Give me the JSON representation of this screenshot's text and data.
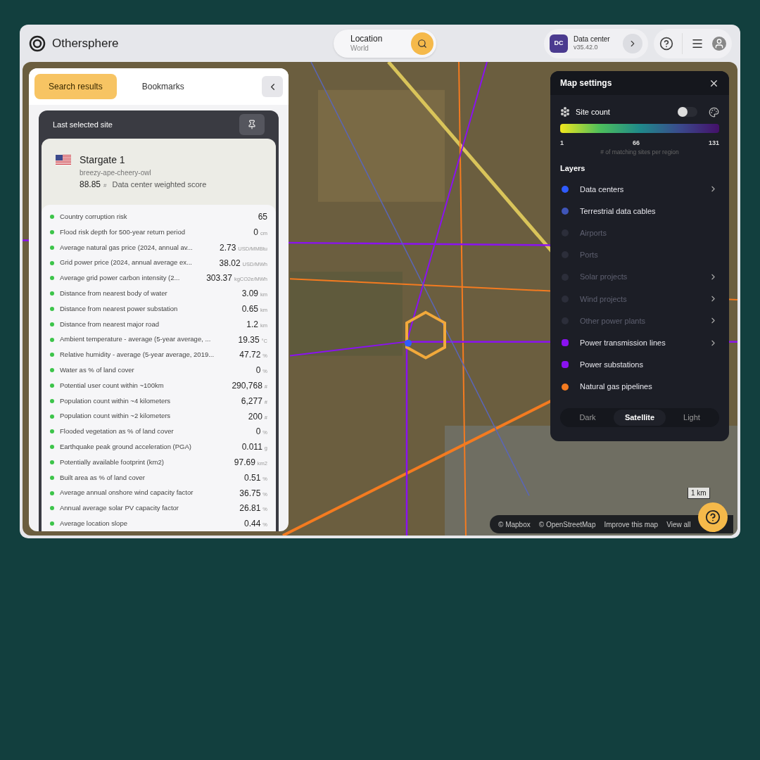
{
  "header": {
    "brand": "Othersphere",
    "location": {
      "label": "Location",
      "value": "World"
    },
    "workspace": {
      "badge": "DC",
      "name": "Data center",
      "version": "v35.42.0"
    }
  },
  "left_panel": {
    "tabs": [
      {
        "label": "Search results",
        "selected": true
      },
      {
        "label": "Bookmarks",
        "selected": false
      }
    ],
    "card_title": "Last selected site",
    "site": {
      "name": "Stargate 1",
      "slug": "breezy-ape-cheery-owl",
      "score": "88.85",
      "score_unit": "#",
      "score_label": "Data center weighted score"
    },
    "metrics": [
      {
        "label": "Country corruption risk",
        "value": "65"
      },
      {
        "label": "Flood risk depth for 500-year return period",
        "value": "0",
        "unit": "cm"
      },
      {
        "label": "Average natural gas price (2024, annual av...",
        "value": "2.73",
        "unit": "USD/MMBtu"
      },
      {
        "label": "Grid power price (2024, annual average ex...",
        "value": "38.02",
        "unit": "USD/MWh"
      },
      {
        "label": "Average grid power carbon intensity (2...",
        "value": "303.37",
        "unit": "kgCO2e/MWh"
      },
      {
        "label": "Distance from nearest body of water",
        "value": "3.09",
        "unit": "km"
      },
      {
        "label": "Distance from nearest power substation",
        "value": "0.65",
        "unit": "km"
      },
      {
        "label": "Distance from nearest major road",
        "value": "1.2",
        "unit": "km"
      },
      {
        "label": "Ambient temperature - average (5-year average, ...",
        "value": "19.35",
        "unit": "°C"
      },
      {
        "label": "Relative humidity - average (5-year average, 2019...",
        "value": "47.72",
        "unit": "%"
      },
      {
        "label": "Water as % of land cover",
        "value": "0",
        "unit": "%"
      },
      {
        "label": "Potential user count within ~100km",
        "value": "290,768",
        "unit": "#"
      },
      {
        "label": "Population count within ~4 kilometers",
        "value": "6,277",
        "unit": "#"
      },
      {
        "label": "Population count within ~2 kilometers",
        "value": "200",
        "unit": "#"
      },
      {
        "label": "Flooded vegetation as % of land cover",
        "value": "0",
        "unit": "%"
      },
      {
        "label": "Earthquake peak ground acceleration (PGA)",
        "value": "0.011",
        "unit": "g"
      },
      {
        "label": "Potentially available footprint (km2)",
        "value": "97.69",
        "unit": "km2"
      },
      {
        "label": "Built area as % of land cover",
        "value": "0.51",
        "unit": "%"
      },
      {
        "label": "Average annual onshore wind capacity factor",
        "value": "36.75",
        "unit": "%"
      },
      {
        "label": "Annual average solar PV capacity factor",
        "value": "26.81",
        "unit": "%"
      },
      {
        "label": "Average location slope",
        "value": "0.44",
        "unit": "%"
      }
    ]
  },
  "map_settings": {
    "title": "Map settings",
    "site_count": {
      "label": "Site count",
      "on": false,
      "min": "1",
      "mid": "66",
      "max": "131",
      "caption": "# of matching sites per region"
    },
    "layers_title": "Layers",
    "layers": [
      {
        "label": "Data centers",
        "enabled": true,
        "color": "#2f5bff",
        "kind": "circle",
        "submenu": true
      },
      {
        "label": "Terrestrial data cables",
        "enabled": true,
        "color": "#3f55b8",
        "kind": "circle",
        "submenu": false
      },
      {
        "label": "Airports",
        "enabled": false,
        "color": "#2c2e3a",
        "kind": "circle",
        "submenu": false
      },
      {
        "label": "Ports",
        "enabled": false,
        "color": "#2c2e3a",
        "kind": "circle",
        "submenu": false
      },
      {
        "label": "Solar projects",
        "enabled": false,
        "color": "#2c2e3a",
        "kind": "circle",
        "submenu": true
      },
      {
        "label": "Wind projects",
        "enabled": false,
        "color": "#2c2e3a",
        "kind": "circle",
        "submenu": true
      },
      {
        "label": "Other power plants",
        "enabled": false,
        "color": "#2c2e3a",
        "kind": "circle",
        "submenu": true
      },
      {
        "label": "Power transmission lines",
        "enabled": true,
        "color": "#8a12f0",
        "kind": "square",
        "submenu": true
      },
      {
        "label": "Power substations",
        "enabled": true,
        "color": "#8a12f0",
        "kind": "square",
        "submenu": false
      },
      {
        "label": "Natural gas pipelines",
        "enabled": true,
        "color": "#f47b20",
        "kind": "circle",
        "submenu": false
      }
    ],
    "basemaps": [
      {
        "label": "Dark",
        "selected": false
      },
      {
        "label": "Satellite",
        "selected": true
      },
      {
        "label": "Light",
        "selected": false
      }
    ]
  },
  "map": {
    "scale": "1 km",
    "attribution": [
      "© Mapbox",
      "© OpenStreetMap",
      "Improve this map",
      "View all"
    ]
  }
}
